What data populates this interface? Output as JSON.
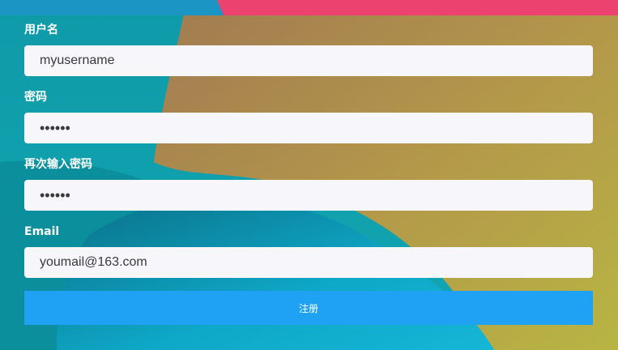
{
  "form": {
    "username_label": "用户名",
    "username_value": "myusername",
    "password_label": "密码",
    "password_value": "••••••",
    "confirm_label": "再次输入密码",
    "confirm_value": "••••••",
    "email_label": "Email",
    "email_value": "youmail@163.com",
    "submit_label": "注册"
  },
  "colors": {
    "button": "#1fa2f4",
    "field_bg": "#f7f6fb",
    "label_text": "#ffffff"
  }
}
